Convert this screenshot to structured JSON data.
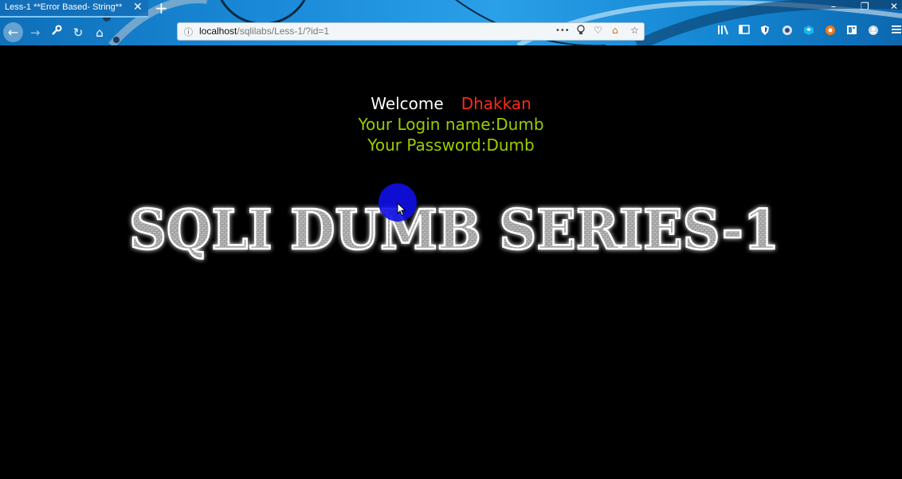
{
  "browser": {
    "tab_title": "Less-1 **Error Based- String**",
    "tab_close": "✕",
    "new_tab": "+",
    "window_controls": {
      "minimize": "–",
      "restore": "❐",
      "close": "✕"
    },
    "nav": {
      "back": "←",
      "forward": "→",
      "tools": "🔧",
      "reload": "↻",
      "home": "⌂"
    },
    "url_host": "localhost",
    "url_path": "/sqlilabs/Less-1/?id=1",
    "url_info_icon": "ⓘ",
    "url_actions": {
      "more": "•••",
      "pocket": "♡",
      "home": "⌂",
      "bookmark": "☆",
      "tip": "💡"
    },
    "toolbar_icons": [
      "library-icon",
      "sidebar-icon",
      "extension-icon",
      "extension-icon",
      "extension-icon",
      "extension-icon",
      "reader-icon",
      "account-icon",
      "menu-icon"
    ],
    "accent": "#1a8ad8"
  },
  "page": {
    "welcome_word": "Welcome",
    "welcome_name": "Dhakkan",
    "login_line": "Your Login name:Dumb",
    "password_line": "Your Password:Dumb",
    "banner_text": "SQLI DUMB SERIES-1",
    "colors": {
      "background": "#000000",
      "welcome": "#ffffff",
      "name": "#ff2a1a",
      "info": "#9acd00"
    }
  }
}
